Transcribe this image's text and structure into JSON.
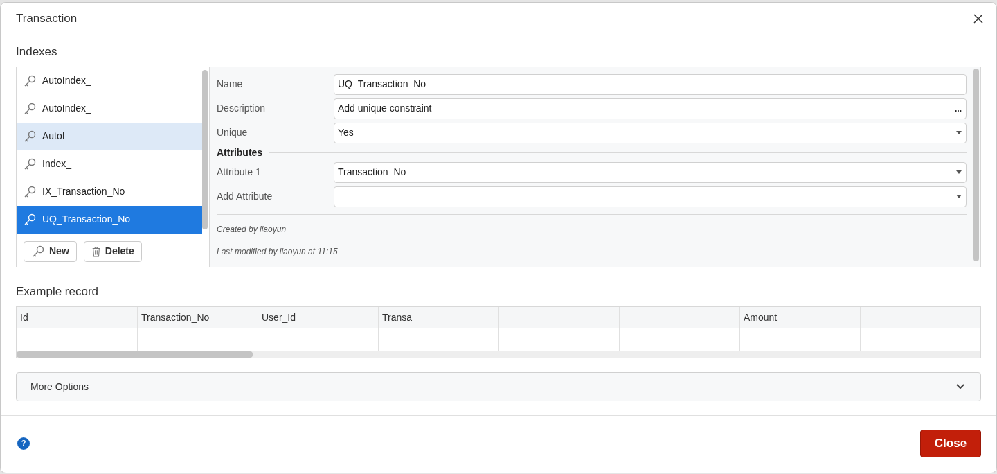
{
  "dialog": {
    "title": "Transaction"
  },
  "indexes": {
    "heading": "Indexes",
    "items": [
      {
        "label": "AutoIndex_",
        "selected": false,
        "hovered": false
      },
      {
        "label": "AutoIndex_",
        "selected": false,
        "hovered": false
      },
      {
        "label": "AutoI",
        "selected": false,
        "hovered": true
      },
      {
        "label": "Index_",
        "selected": false,
        "hovered": false
      },
      {
        "label": "IX_Transaction_No",
        "selected": false,
        "hovered": false
      },
      {
        "label": "UQ_Transaction_No",
        "selected": true,
        "hovered": false
      }
    ],
    "buttons": [
      {
        "kind": "new",
        "label": "New"
      },
      {
        "kind": "delete",
        "label": "Delete"
      }
    ]
  },
  "form": {
    "fields": [
      {
        "label": "Name",
        "kind": "text",
        "value": "UQ_Transaction_No"
      },
      {
        "label": "Description",
        "kind": "ellipsis",
        "value": "Add unique constraint",
        "button": "..."
      },
      {
        "label": "Unique",
        "kind": "select",
        "value": "Yes"
      }
    ],
    "section": "Attributes",
    "attributes": [
      {
        "label": "Attribute 1",
        "kind": "select",
        "value": "Transaction_No"
      },
      {
        "label": "Add Attribute",
        "kind": "select"
      }
    ],
    "created": "Created by liaoyun",
    "modified": "Last modified by liaoyun at 11:15"
  },
  "example_record": {
    "heading": "Example record",
    "columns": [
      {
        "label": "Id"
      },
      {
        "label": "Transaction_No"
      },
      {
        "label": "User_Id"
      },
      {
        "label": "Transa"
      },
      {},
      {},
      {
        "label": "Amount"
      },
      {}
    ]
  },
  "more_options": {
    "label": "More Options",
    "expanded": false
  },
  "footer": {
    "help": "?",
    "close": "Close"
  }
}
